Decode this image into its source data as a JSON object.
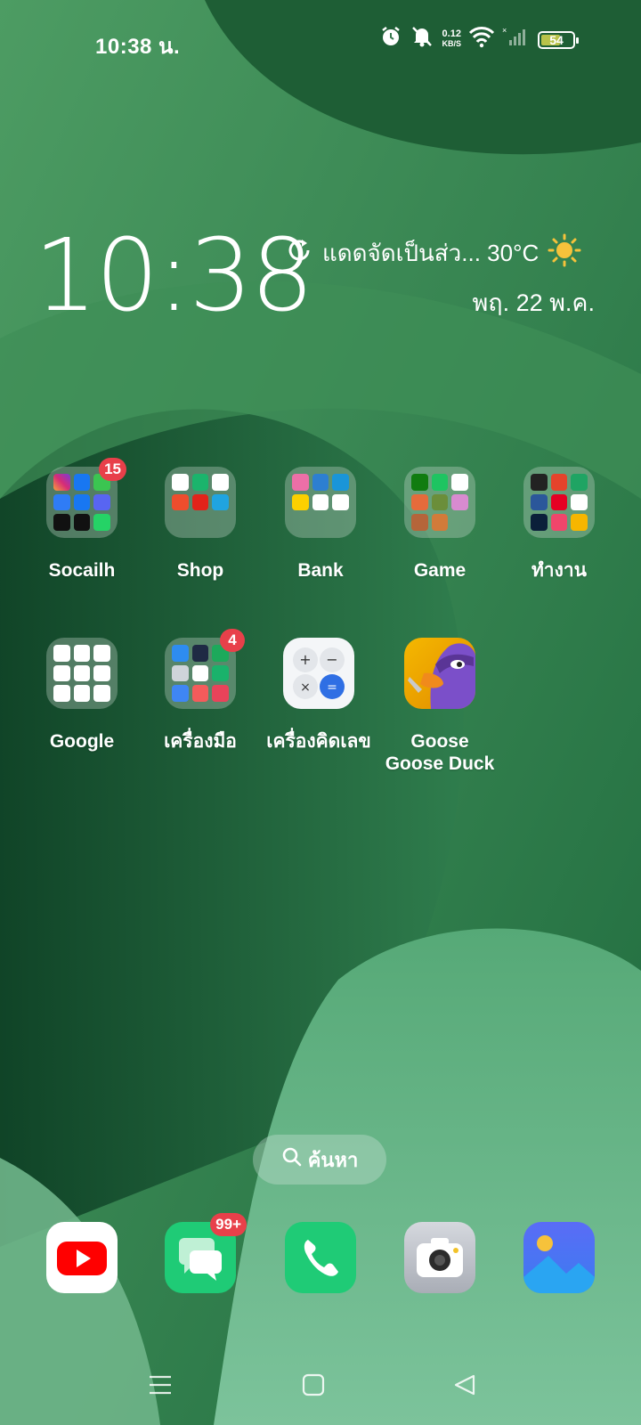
{
  "status_bar": {
    "time": "10:38 น.",
    "net_speed_value": "0.12",
    "net_speed_unit": "KB/S",
    "battery": "54",
    "icons": [
      "alarm-icon",
      "mute-icon",
      "wifi-icon",
      "signal-icon",
      "battery-icon"
    ]
  },
  "clock_widget": {
    "time": "10:38",
    "weather_text": "แดดจัดเป็นส่ว... 30°C",
    "date": "พฤ. 22 พ.ค."
  },
  "apps": [
    {
      "label": "Socailh",
      "type": "folder",
      "badge": "15"
    },
    {
      "label": "Shop",
      "type": "folder"
    },
    {
      "label": "Bank",
      "type": "folder"
    },
    {
      "label": "Game",
      "type": "folder"
    },
    {
      "label": "ทำงาน",
      "type": "folder"
    },
    {
      "label": "Google",
      "type": "folder"
    },
    {
      "label": "เครื่องมือ",
      "type": "folder",
      "badge": "4"
    },
    {
      "label": "เครื่องคิดเลข",
      "type": "app"
    },
    {
      "label_line1": "Goose",
      "label_line2": "Goose Duck",
      "type": "app"
    }
  ],
  "search": {
    "label": "ค้นหา"
  },
  "dock": [
    {
      "name": "youtube"
    },
    {
      "name": "messages",
      "badge": "99+"
    },
    {
      "name": "phone"
    },
    {
      "name": "camera"
    },
    {
      "name": "gallery"
    }
  ],
  "colors": {
    "badge": "#e8404a",
    "wallpaper_dark": "#0f4a2a",
    "wallpaper_light": "#4f9d68"
  }
}
